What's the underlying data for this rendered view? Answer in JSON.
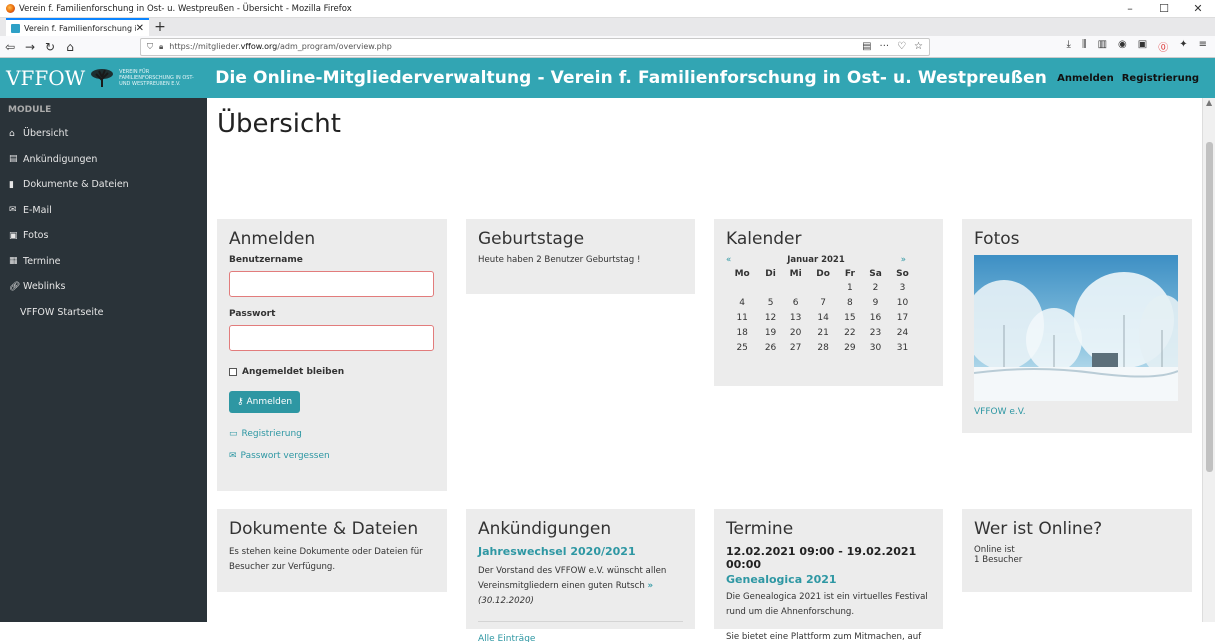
{
  "browser": {
    "window_title": "Verein f. Familienforschung in Ost- u. Westpreußen - Übersicht - Mozilla Firefox",
    "tab_title": "Verein f. Familienforschung in O",
    "url_prefix": "https://mitglieder.",
    "url_domain": "vffow.org",
    "url_path": "/adm_program/overview.php"
  },
  "header": {
    "brand": "VFFOW",
    "brand_sub": "VEREIN FÜR FAMILIENFORSCHUNG IN OST- UND WESTPREUßEN E.V.",
    "title": "Die Online-Mitgliederverwaltung - Verein f. Familienforschung in Ost- u. Westpreußen",
    "login": "Anmelden",
    "register": "Registrierung"
  },
  "sidebar": {
    "heading": "MODULE",
    "items": [
      {
        "label": "Übersicht",
        "icon": "home-icon"
      },
      {
        "label": "Ankündigungen",
        "icon": "newspaper-icon"
      },
      {
        "label": "Dokumente & Dateien",
        "icon": "file-icon"
      },
      {
        "label": "E-Mail",
        "icon": "mail-icon"
      },
      {
        "label": "Fotos",
        "icon": "image-icon"
      },
      {
        "label": "Termine",
        "icon": "calendar-icon"
      },
      {
        "label": "Weblinks",
        "icon": "link-icon"
      },
      {
        "label": "VFFOW Startseite",
        "icon": ""
      }
    ]
  },
  "main": {
    "page_title": "Übersicht",
    "login": {
      "title": "Anmelden",
      "username_label": "Benutzername",
      "username_value": "",
      "password_label": "Passwort",
      "password_value": "",
      "remember_label": "Angemeldet bleiben",
      "submit_label": "Anmelden",
      "register_link": "Registrierung",
      "forgot_link": "Passwort vergessen"
    },
    "birthdays": {
      "title": "Geburtstage",
      "text": "Heute haben 2 Benutzer Geburtstag !"
    },
    "calendar": {
      "title": "Kalender",
      "prev": "«",
      "next": "»",
      "month": "Januar 2021",
      "weekdays": [
        "Mo",
        "Di",
        "Mi",
        "Do",
        "Fr",
        "Sa",
        "So"
      ],
      "weeks": [
        [
          "",
          "",
          "",
          "",
          "1",
          "2",
          "3"
        ],
        [
          "4",
          "5",
          "6",
          "7",
          "8",
          "9",
          "10"
        ],
        [
          "11",
          "12",
          "13",
          "14",
          "15",
          "16",
          "17"
        ],
        [
          "18",
          "19",
          "20",
          "21",
          "22",
          "23",
          "24"
        ],
        [
          "25",
          "26",
          "27",
          "28",
          "29",
          "30",
          "31"
        ]
      ]
    },
    "photos": {
      "title": "Fotos",
      "caption": "VFFOW e.V."
    },
    "documents": {
      "title": "Dokumente & Dateien",
      "text": "Es stehen keine Dokumente oder Dateien für Besucher zur Verfügung."
    },
    "announcements": {
      "title": "Ankündigungen",
      "item_title": "Jahreswechsel 2020/2021",
      "item_text": "Der Vorstand des VFFOW e.V. wünscht allen Vereinsmitgliedern einen guten Rutsch",
      "item_more": "»",
      "item_date": "(30.12.2020)",
      "all_link": "Alle Einträge"
    },
    "events": {
      "title": "Termine",
      "date": "12.02.2021  09:00 - 19.02.2021 00:00",
      "event_title": "Genealogica 2021",
      "text1": "Die Genealogica 2021 ist ein virtuelles Festival rund um die Ahnenforschung.",
      "text2": "Sie bietet eine Plattform zum Mitmachen, auf"
    },
    "online": {
      "title": "Wer ist Online?",
      "line1": "Online ist",
      "line2": "1 Besucher"
    }
  },
  "colors": {
    "accent": "#32a5b3",
    "sidebar": "#2a3339",
    "card": "#ececec",
    "link": "#2e97a3"
  }
}
